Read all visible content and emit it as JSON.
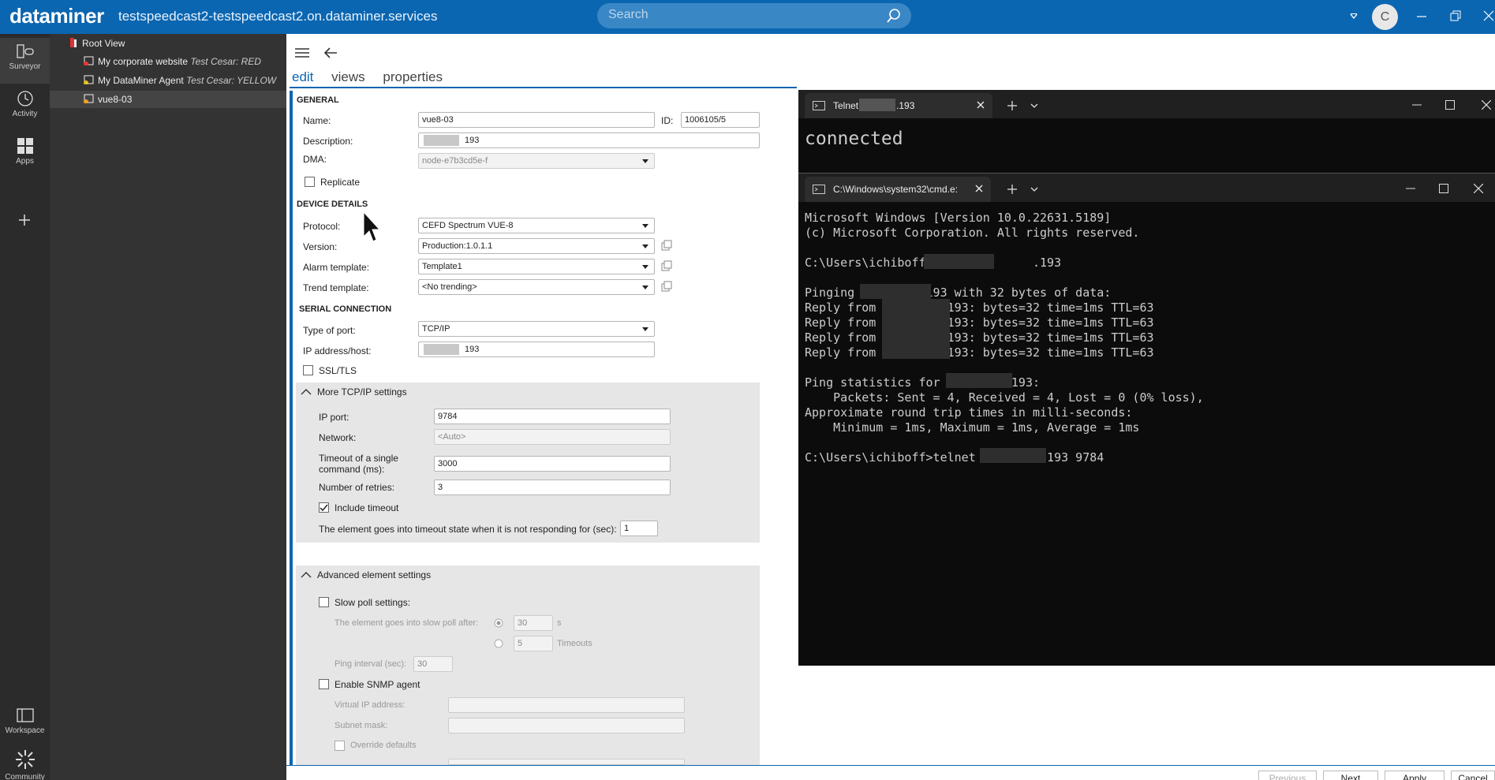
{
  "topbar": {
    "logo": "dataminer",
    "host": "testspeedcast2-testspeedcast2.on.dataminer.services",
    "search_placeholder": "Search",
    "avatar_letter": "C"
  },
  "rail": {
    "surveyor": "Surveyor",
    "activity": "Activity",
    "apps": "Apps",
    "workspace": "Workspace",
    "community": "Community"
  },
  "tree": {
    "root": "Root View",
    "items": [
      {
        "name": "My corporate website",
        "note": "Test Cesar: RED"
      },
      {
        "name": "My DataMiner Agent",
        "note": "Test Cesar: YELLOW"
      },
      {
        "name": "vue8-03",
        "note": ""
      }
    ]
  },
  "editor": {
    "tabs": [
      "edit",
      "views",
      "properties"
    ],
    "general": {
      "title": "GENERAL",
      "name_label": "Name:",
      "name_value": "vue8-03",
      "id_label": "ID:",
      "id_value": "1006105/5",
      "description_label": "Description:",
      "description_value": "193",
      "dma_label": "DMA:",
      "dma_value": "node-e7b3cd5e-f",
      "replicate_label": "Replicate"
    },
    "device": {
      "title": "DEVICE DETAILS",
      "protocol_label": "Protocol:",
      "protocol_value": "CEFD Spectrum VUE-8",
      "version_label": "Version:",
      "version_value": "Production:1.0.1.1",
      "alarm_label": "Alarm template:",
      "alarm_value": "Template1",
      "trend_label": "Trend template:",
      "trend_value": "<No trending>"
    },
    "serial": {
      "title": "SERIAL CONNECTION",
      "port_type_label": "Type of port:",
      "port_type_value": "TCP/IP",
      "ip_label": "IP address/host:",
      "ip_value": "193",
      "ssl_label": "SSL/TLS"
    },
    "tcp": {
      "title": "More TCP/IP settings",
      "ipport_label": "IP port:",
      "ipport_value": "9784",
      "network_label": "Network:",
      "network_value": "<Auto>",
      "timeout_label": "Timeout of a single command (ms):",
      "timeout_value": "3000",
      "retries_label": "Number of retries:",
      "retries_value": "3",
      "include_timeout_label": "Include timeout",
      "timeout_state_label": "The element goes into timeout state when it is not responding for (sec):",
      "timeout_state_value": "1"
    },
    "advanced": {
      "title": "Advanced element settings",
      "slowpoll_label": "Slow poll settings:",
      "slowpoll_after_label": "The element goes into slow poll after:",
      "slowpoll_after_value": "30",
      "slowpoll_after_unit": "s",
      "timeouts_value": "5",
      "timeouts_unit": "Timeouts",
      "ping_label": "Ping interval (sec):",
      "ping_value": "30",
      "snmp_label": "Enable SNMP agent",
      "vip_label": "Virtual IP address:",
      "subnet_label": "Subnet mask:",
      "override_label": "Override defaults"
    },
    "buttons": {
      "previous": "Previous",
      "next": "Next",
      "apply": "Apply",
      "cancel": "Cancel"
    }
  },
  "telnet": {
    "tab": "Telnet",
    "tab_suffix": ".193",
    "output": "connected"
  },
  "cmd": {
    "tab": "C:\\Windows\\system32\\cmd.e:",
    "lines": [
      "Microsoft Windows [Version 10.0.22631.5189]",
      "(c) Microsoft Corporation. All rights reserved.",
      "",
      "C:\\Users\\ichiboff>ping          .193",
      "",
      "Pinging          193 with 32 bytes of data:",
      "Reply from         .193: bytes=32 time=1ms TTL=63",
      "Reply from         .193: bytes=32 time=1ms TTL=63",
      "Reply from         .193: bytes=32 time=1ms TTL=63",
      "Reply from         .193: bytes=32 time=1ms TTL=63",
      "",
      "Ping statistics for         .193:",
      "    Packets: Sent = 4, Received = 4, Lost = 0 (0% loss),",
      "Approximate round trip times in milli-seconds:",
      "    Minimum = 1ms, Maximum = 1ms, Average = 1ms",
      "",
      "C:\\Users\\ichiboff>telnet         .193 9784"
    ]
  }
}
